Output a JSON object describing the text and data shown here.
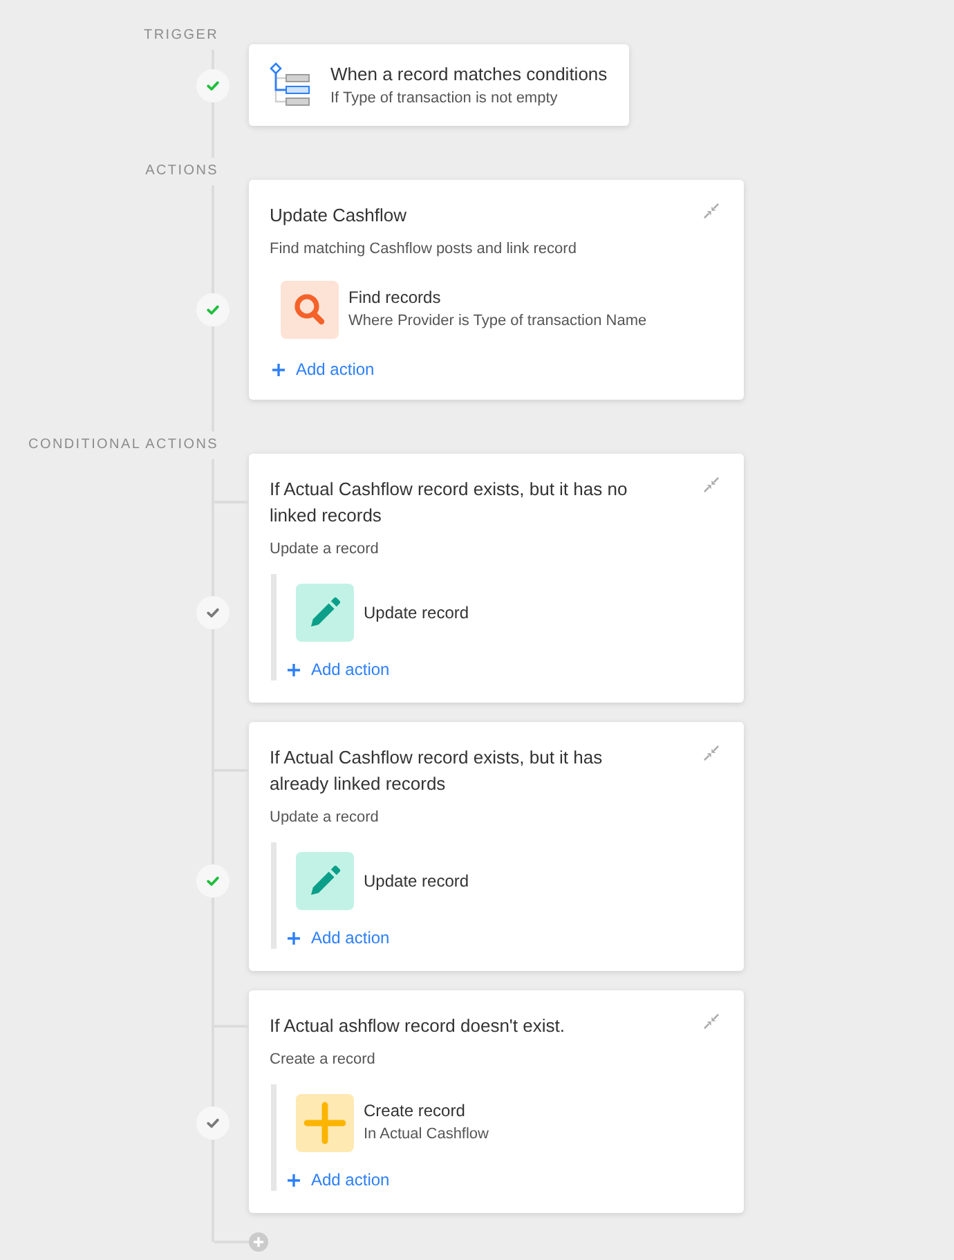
{
  "sections": [
    {
      "label": "TRIGGER",
      "steps": [
        {
          "kind": "trigger",
          "succeeded": true,
          "title": "When a record matches conditions",
          "condition": "If Type of transaction is not empty"
        }
      ]
    },
    {
      "label": "ACTIONS",
      "steps": [
        {
          "kind": "action",
          "succeeded": true,
          "title": "Update Cashflow",
          "description": "Find matching Cashflow posts and link record",
          "actions": [
            {
              "kind": "find",
              "title": "Find records",
              "detail": "Where Provider is Type of transaction Name"
            }
          ],
          "add_action": "Add action"
        }
      ]
    },
    {
      "label": "CONDITIONAL ACTIONS",
      "steps": [
        {
          "kind": "condition",
          "succeeded": false,
          "title": "If Actual Cashflow record exists, but it has no linked records",
          "description": "Update a record",
          "actions": [
            {
              "kind": "update",
              "title": "Update record"
            }
          ],
          "add_action": "Add action"
        },
        {
          "kind": "condition",
          "succeeded": true,
          "title": "If Actual Cashflow record exists, but it has already linked records",
          "description": "Update a record",
          "actions": [
            {
              "kind": "update",
              "title": "Update record"
            }
          ],
          "add_action": "Add action"
        },
        {
          "kind": "condition",
          "succeeded": false,
          "title": "If Actual ashflow record doesn't exist.",
          "description": "Create a record",
          "actions": [
            {
              "kind": "create",
              "title": "Create record",
              "detail": "In Actual Cashflow"
            }
          ],
          "add_action": "Add action"
        }
      ]
    }
  ]
}
